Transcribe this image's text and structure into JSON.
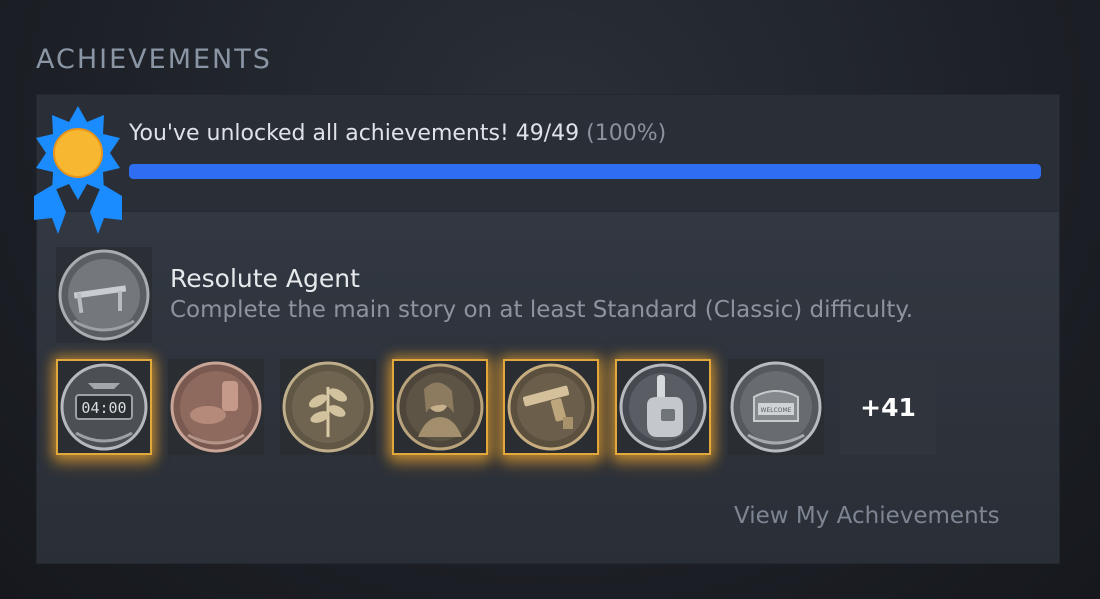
{
  "section": {
    "title": "ACHIEVEMENTS"
  },
  "summary": {
    "unlocked_text": "You've unlocked all achievements! 49/49",
    "percent_text": "(100%)",
    "progress_fraction": 1.0,
    "progress_color": "#2f6ef2",
    "medal_icon": "medal-ribbon-icon"
  },
  "featured": {
    "title": "Resolute Agent",
    "description": "Complete the main story on at least Standard (Classic) difficulty.",
    "icon": "knife-achievement-icon"
  },
  "achievements": [
    {
      "icon": "timer-achievement-icon",
      "clock_text": "04:00",
      "highlighted": true
    },
    {
      "icon": "ammo-achievement-icon",
      "highlighted": false
    },
    {
      "icon": "herb-achievement-icon",
      "highlighted": false
    },
    {
      "icon": "character-achievement-icon",
      "highlighted": true
    },
    {
      "icon": "handgun-achievement-icon",
      "highlighted": true
    },
    {
      "icon": "hand-device-achievement-icon",
      "highlighted": true
    },
    {
      "icon": "welcome-sign-achievement-icon",
      "sign_text": "WELCOME",
      "highlighted": false
    }
  ],
  "more": {
    "label": "+41"
  },
  "footer": {
    "link_label": "View My Achievements"
  },
  "colors": {
    "glow": "#e3a83c",
    "accent_blue": "#2f6ef2",
    "medal_blue": "#1a8cff",
    "medal_gold": "#f7b731"
  }
}
